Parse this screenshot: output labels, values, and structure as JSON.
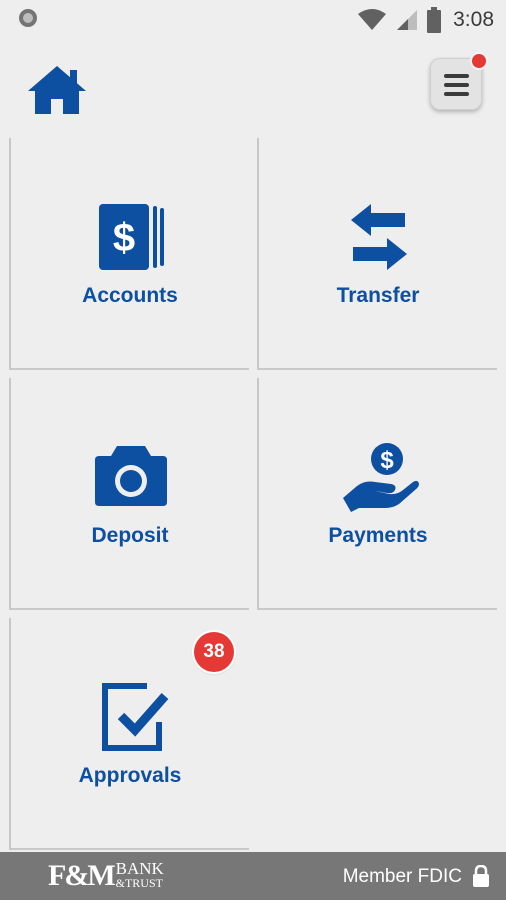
{
  "status_bar": {
    "time": "3:08",
    "icons": [
      "notification-dot-icon",
      "wifi-icon",
      "signal-icon",
      "battery-icon"
    ]
  },
  "header": {
    "icons": [
      "home-icon",
      "menu-icon"
    ]
  },
  "tiles": [
    {
      "label": "Accounts",
      "icon": "accounts-icon"
    },
    {
      "label": "Transfer",
      "icon": "transfer-icon"
    },
    {
      "label": "Deposit",
      "icon": "camera-icon"
    },
    {
      "label": "Payments",
      "icon": "payments-icon"
    },
    {
      "label": "Approvals",
      "icon": "approvals-icon",
      "badge": "38"
    }
  ],
  "footer": {
    "logo": {
      "letters": "F&M",
      "line1": "BANK",
      "line2": "&TRUST"
    },
    "fdic": "Member FDIC"
  },
  "colors": {
    "brand_blue": "#0d4fa0",
    "badge_red": "#e53935",
    "footer_gray": "#777777",
    "background": "#eeeeee"
  }
}
